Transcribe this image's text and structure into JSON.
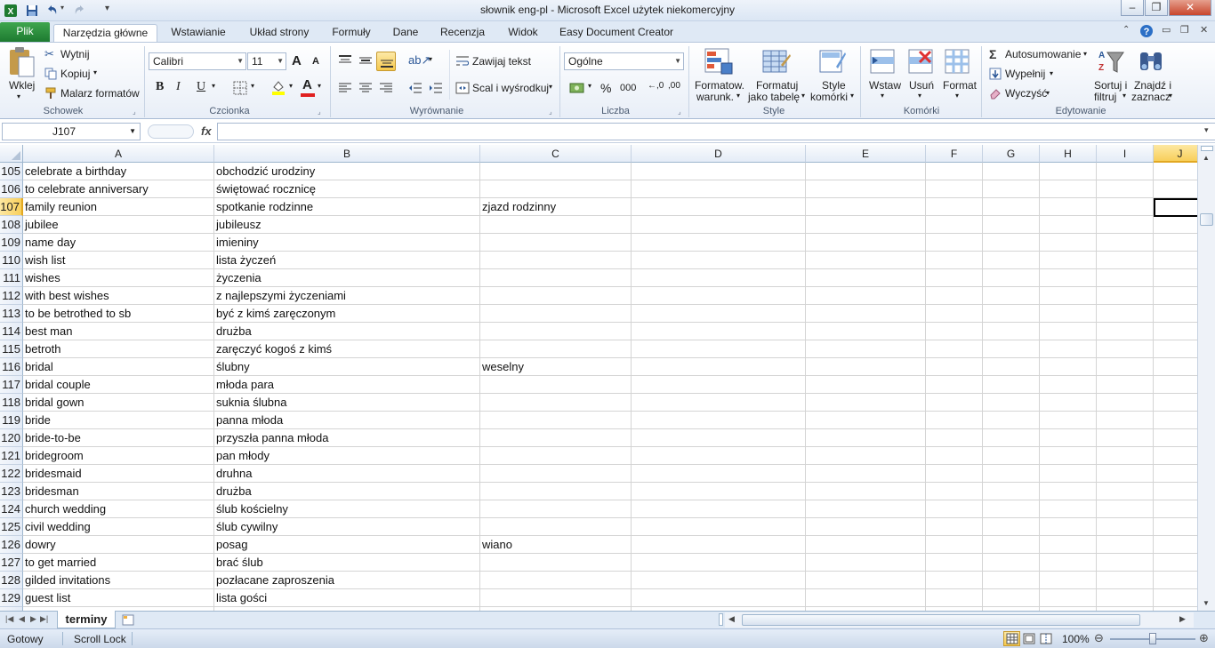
{
  "window": {
    "title": "słownik eng-pl  -  Microsoft Excel użytek niekomercyjny",
    "minimize": "–",
    "maximize": "❐",
    "close": "✕"
  },
  "tabs": [
    {
      "label": "Plik"
    },
    {
      "label": "Narzędzia główne"
    },
    {
      "label": "Wstawianie"
    },
    {
      "label": "Układ strony"
    },
    {
      "label": "Formuły"
    },
    {
      "label": "Dane"
    },
    {
      "label": "Recenzja"
    },
    {
      "label": "Widok"
    },
    {
      "label": "Easy Document Creator"
    }
  ],
  "ribbon": {
    "clipboard": {
      "paste": "Wklej",
      "cut": "Wytnij",
      "copy": "Kopiuj",
      "format_painter": "Malarz formatów",
      "group": "Schowek"
    },
    "font": {
      "name": "Calibri",
      "size": "11",
      "bold": "B",
      "italic": "I",
      "underline": "U",
      "grow": "A",
      "shrink": "A",
      "font_color": "A",
      "group": "Czcionka"
    },
    "alignment": {
      "wrap": "Zawijaj tekst",
      "merge": "Scal i wyśrodkuj",
      "group": "Wyrównanie"
    },
    "number": {
      "format": "Ogólne",
      "percent": "%",
      "thousands": "000",
      "group": "Liczba"
    },
    "styles": {
      "conditional_1": "Formatow.",
      "conditional_2": "warunk.",
      "as_table_1": "Formatuj",
      "as_table_2": "jako tabelę",
      "cell_styles_1": "Style",
      "cell_styles_2": "komórki",
      "group": "Style"
    },
    "cells": {
      "insert": "Wstaw",
      "delete": "Usuń",
      "format": "Format",
      "group": "Komórki"
    },
    "editing": {
      "autosum": "Autosumowanie",
      "fill": "Wypełnij",
      "clear": "Wyczyść",
      "sort_1": "Sortuj i",
      "sort_2": "filtruj",
      "find_1": "Znajdź i",
      "find_2": "zaznacz",
      "group": "Edytowanie"
    }
  },
  "formula_bar": {
    "name_box": "J107",
    "fx": "fx",
    "formula": ""
  },
  "columns": [
    "A",
    "B",
    "C",
    "D",
    "E",
    "F",
    "G",
    "H",
    "I",
    "J"
  ],
  "selected_column": "J",
  "selected_row": "107",
  "rows": [
    {
      "n": "105",
      "a": "celebrate a birthday",
      "b": "obchodzić urodziny",
      "c": ""
    },
    {
      "n": "106",
      "a": "to celebrate anniversary",
      "b": "świętować rocznicę",
      "c": ""
    },
    {
      "n": "107",
      "a": "family reunion",
      "b": "spotkanie rodzinne",
      "c": "zjazd rodzinny"
    },
    {
      "n": "108",
      "a": "jubilee",
      "b": "jubileusz",
      "c": ""
    },
    {
      "n": "109",
      "a": "name day",
      "b": "imieniny",
      "c": ""
    },
    {
      "n": "110",
      "a": "wish list",
      "b": "lista życzeń",
      "c": ""
    },
    {
      "n": "111",
      "a": "wishes",
      "b": "życzenia",
      "c": ""
    },
    {
      "n": "112",
      "a": "with best wishes",
      "b": "z najlepszymi życzeniami",
      "c": ""
    },
    {
      "n": "113",
      "a": "to be betrothed to sb",
      "b": "być z kimś zaręczonym",
      "c": ""
    },
    {
      "n": "114",
      "a": "best man",
      "b": "drużba",
      "c": ""
    },
    {
      "n": "115",
      "a": "betroth",
      "b": "zaręczyć kogoś z kimś",
      "c": ""
    },
    {
      "n": "116",
      "a": "bridal",
      "b": "ślubny",
      "c": "weselny"
    },
    {
      "n": "117",
      "a": "bridal couple",
      "b": "młoda para",
      "c": ""
    },
    {
      "n": "118",
      "a": "bridal gown",
      "b": "suknia ślubna",
      "c": ""
    },
    {
      "n": "119",
      "a": "bride",
      "b": "panna młoda",
      "c": ""
    },
    {
      "n": "120",
      "a": "bride-to-be",
      "b": "przyszła panna młoda",
      "c": ""
    },
    {
      "n": "121",
      "a": "bridegroom",
      "b": "pan młody",
      "c": ""
    },
    {
      "n": "122",
      "a": "bridesmaid",
      "b": "druhna",
      "c": ""
    },
    {
      "n": "123",
      "a": "bridesman",
      "b": "drużba",
      "c": ""
    },
    {
      "n": "124",
      "a": "church wedding",
      "b": "ślub kościelny",
      "c": ""
    },
    {
      "n": "125",
      "a": "civil wedding",
      "b": "ślub cywilny",
      "c": ""
    },
    {
      "n": "126",
      "a": "dowry",
      "b": "posag",
      "c": "wiano"
    },
    {
      "n": "127",
      "a": "to get married",
      "b": "brać ślub",
      "c": ""
    },
    {
      "n": "128",
      "a": "gilded invitations",
      "b": "pozłacane zaproszenia",
      "c": ""
    },
    {
      "n": "129",
      "a": "guest list",
      "b": "lista gości",
      "c": ""
    }
  ],
  "sheet_tabs": [
    {
      "label": "terminy"
    }
  ],
  "status": {
    "ready": "Gotowy",
    "scroll_lock": "Scroll Lock",
    "zoom": "100%"
  },
  "colors": {
    "file_tab": "#2a8a3c",
    "selection_header": "#f8cf5b",
    "ribbon_bg": "#e8eef7"
  },
  "icons": [
    "excel-logo-icon",
    "save-icon",
    "undo-icon",
    "redo-icon",
    "help-icon",
    "paste-icon",
    "scissors-icon",
    "copy-icon",
    "brush-icon",
    "sigma-icon",
    "funnel-icon",
    "binoculars-icon"
  ]
}
